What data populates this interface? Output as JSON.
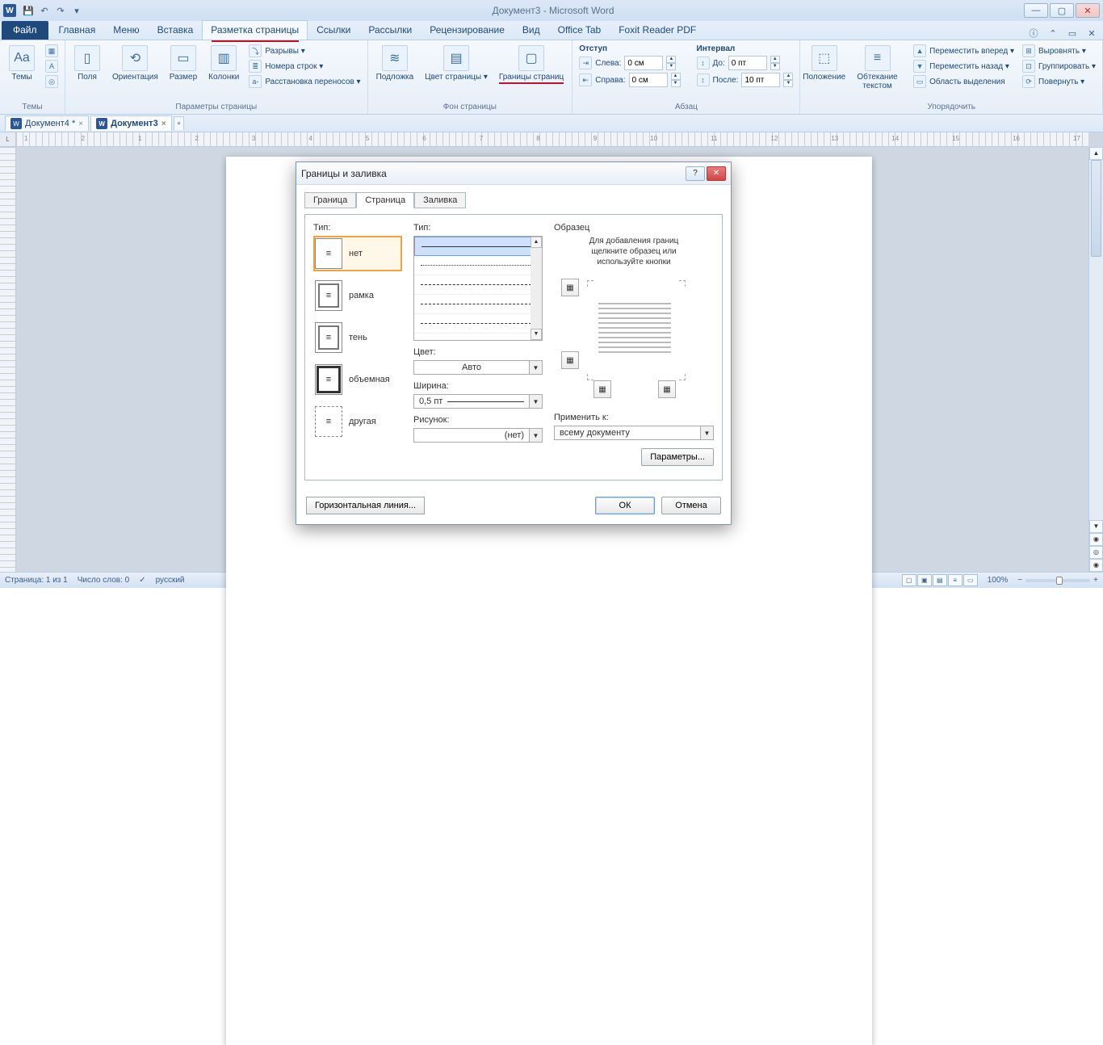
{
  "title": "Документ3 - Microsoft Word",
  "qat": {
    "save": "💾",
    "undo": "↶",
    "redo": "↷"
  },
  "tabs": {
    "file": "Файл",
    "home": "Главная",
    "menu": "Меню",
    "insert": "Вставка",
    "layout": "Разметка страницы",
    "refs": "Ссылки",
    "mail": "Рассылки",
    "review": "Рецензирование",
    "view": "Вид",
    "office": "Office Tab",
    "foxit": "Foxit Reader PDF"
  },
  "ribbon": {
    "themes": {
      "big": "Темы",
      "title": "Темы"
    },
    "pagesetup": {
      "margins": "Поля",
      "orient": "Ориентация",
      "size": "Размер",
      "columns": "Колонки",
      "breaks": "Разрывы ▾",
      "lines": "Номера строк ▾",
      "hyphen": "Расстановка переносов ▾",
      "title": "Параметры страницы"
    },
    "pagebg": {
      "watermark": "Подложка",
      "color": "Цвет\nстраницы ▾",
      "borders": "Границы\nстраниц",
      "title": "Фон страницы"
    },
    "indent": {
      "title": "Отступ",
      "left": "Слева:",
      "right": "Справа:",
      "vleft": "0 см",
      "vright": "0 см"
    },
    "spacing": {
      "title": "Интервал",
      "before": "До:",
      "after": "После:",
      "vbefore": "0 пт",
      "vafter": "10 пт"
    },
    "para_title": "Абзац",
    "arrange": {
      "pos": "Положение",
      "wrap": "Обтекание\nтекстом",
      "forward": "Переместить вперед ▾",
      "backward": "Переместить назад ▾",
      "pane": "Область выделения",
      "align": "Выровнять ▾",
      "group": "Группировать ▾",
      "rotate": "Повернуть ▾",
      "title": "Упорядочить"
    }
  },
  "doctabs": {
    "d1": "Документ4 *",
    "d2": "Документ3"
  },
  "dialog": {
    "title": "Границы и заливка",
    "tabs": {
      "t1": "Граница",
      "t2": "Страница",
      "t3": "Заливка"
    },
    "type_label": "Тип:",
    "types": {
      "none": "нет",
      "box": "рамка",
      "shadow": "тень",
      "threed": "объемная",
      "custom": "другая"
    },
    "style_label": "Тип:",
    "color_label": "Цвет:",
    "color_value": "Авто",
    "width_label": "Ширина:",
    "width_value": "0,5 пт",
    "art_label": "Рисунок:",
    "art_value": "(нет)",
    "preview_label": "Образец",
    "preview_hint1": "Для добавления границ",
    "preview_hint2": "щелкните образец или",
    "preview_hint3": "используйте кнопки",
    "apply_label": "Применить к:",
    "apply_value": "всему документу",
    "params": "Параметры...",
    "hline": "Горизонтальная линия...",
    "ok": "ОК",
    "cancel": "Отмена"
  },
  "status": {
    "page": "Страница: 1 из 1",
    "words": "Число слов: 0",
    "lang": "русский",
    "zoom": "100%"
  },
  "ruler_corner": "L",
  "ruler_marks": [
    "1",
    "2",
    "1",
    "2",
    "3",
    "4",
    "5",
    "6",
    "7",
    "8",
    "9",
    "10",
    "11",
    "12",
    "13",
    "14",
    "15",
    "16",
    "17"
  ]
}
